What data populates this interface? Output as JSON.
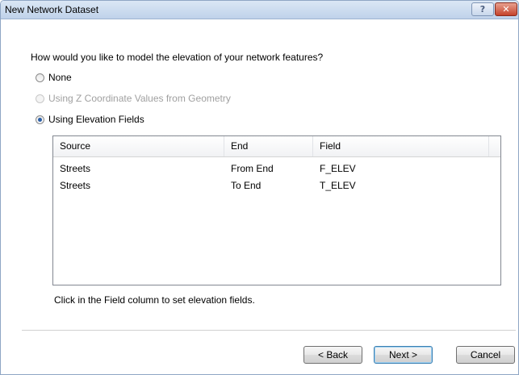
{
  "window": {
    "title": "New Network Dataset",
    "help_glyph": "?",
    "close_glyph": "✕"
  },
  "prompt": "How would you like to model the elevation of your network features?",
  "options": [
    {
      "label": "None",
      "checked": false,
      "enabled": true
    },
    {
      "label": "Using Z Coordinate Values from Geometry",
      "checked": false,
      "enabled": false
    },
    {
      "label": "Using Elevation Fields",
      "checked": true,
      "enabled": true
    }
  ],
  "table": {
    "headers": [
      "Source",
      "End",
      "Field"
    ],
    "rows": [
      [
        "Streets",
        "From End",
        "F_ELEV"
      ],
      [
        "Streets",
        "To End",
        "T_ELEV"
      ]
    ]
  },
  "hint": "Click in the Field column to set elevation fields.",
  "buttons": {
    "back": "< Back",
    "next": "Next >",
    "cancel": "Cancel"
  }
}
